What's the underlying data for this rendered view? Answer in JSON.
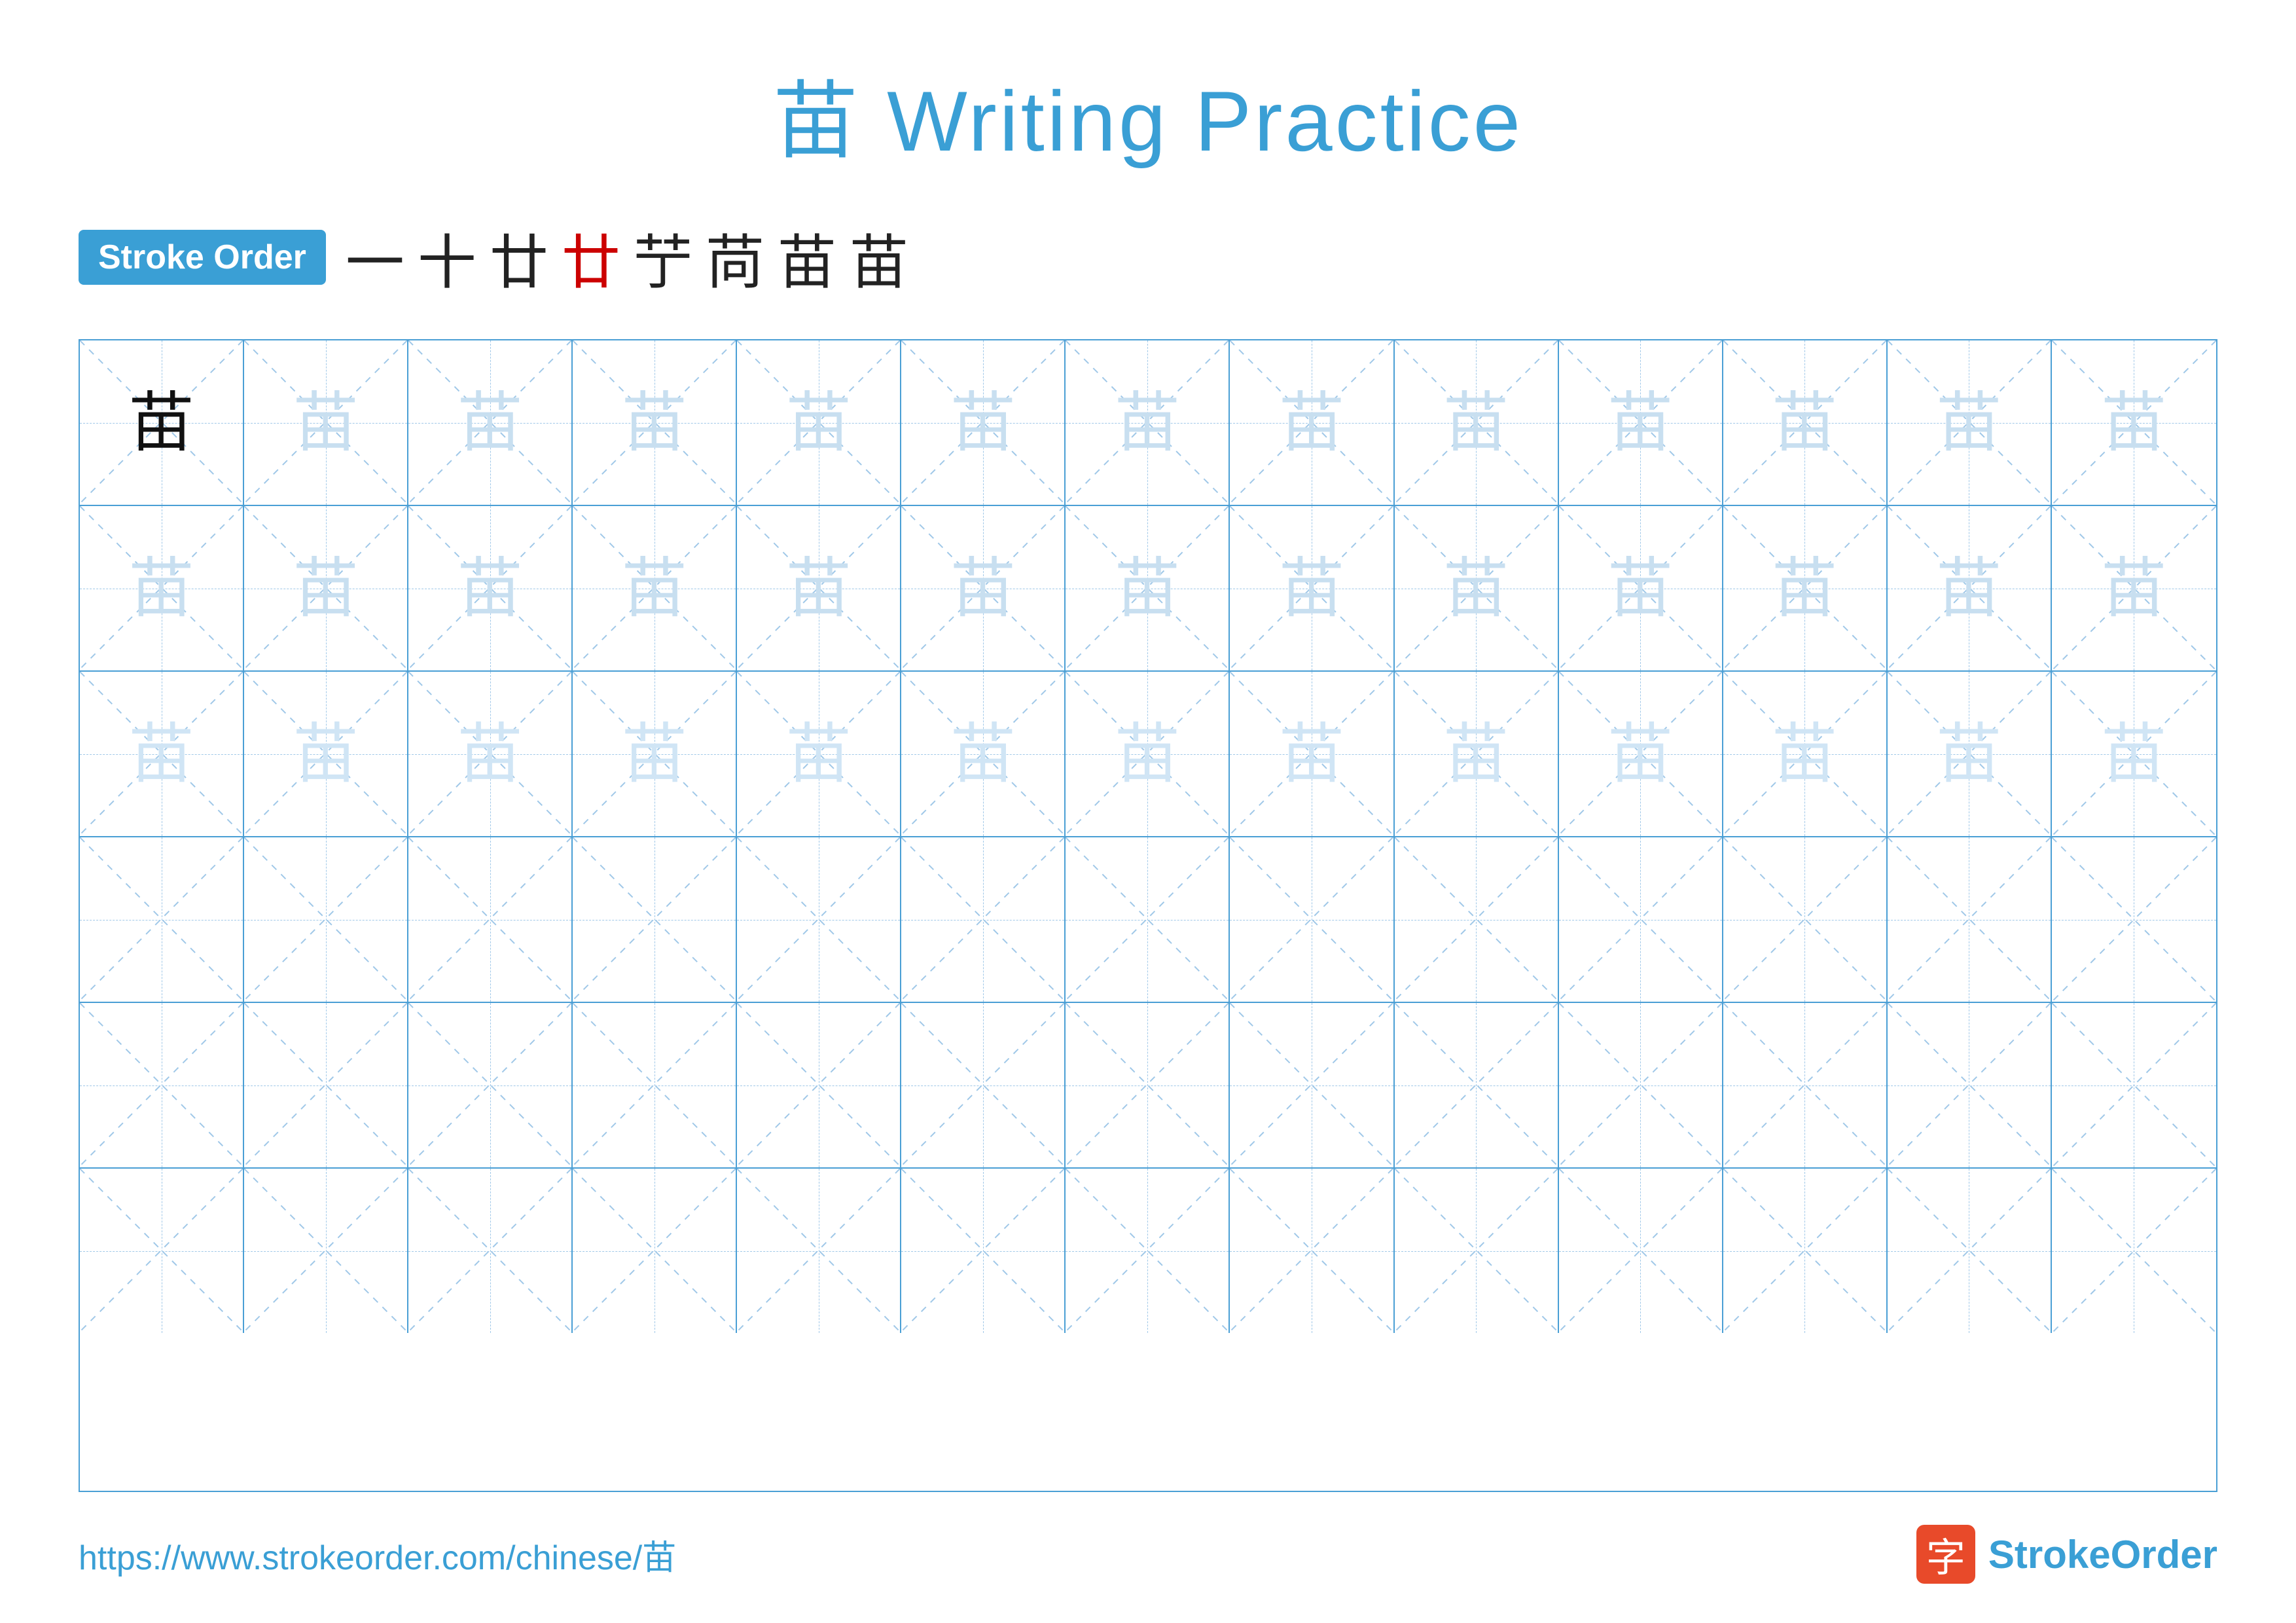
{
  "page": {
    "title": "苗 Writing Practice",
    "title_char": "苗",
    "title_suffix": " Writing Practice"
  },
  "stroke_order": {
    "badge_label": "Stroke Order",
    "strokes": [
      "一",
      "十",
      "廿",
      "廿",
      "苃",
      "苘",
      "苗",
      "苗"
    ],
    "last_stroke_index": 3
  },
  "grid": {
    "rows": 6,
    "cols": 13,
    "char": "苗",
    "row_types": [
      "dark",
      "light1",
      "light2",
      "empty",
      "empty",
      "empty"
    ]
  },
  "footer": {
    "url": "https://www.strokeorder.com/chinese/苗",
    "logo_text": "StrokeOrder",
    "logo_icon": "字"
  }
}
